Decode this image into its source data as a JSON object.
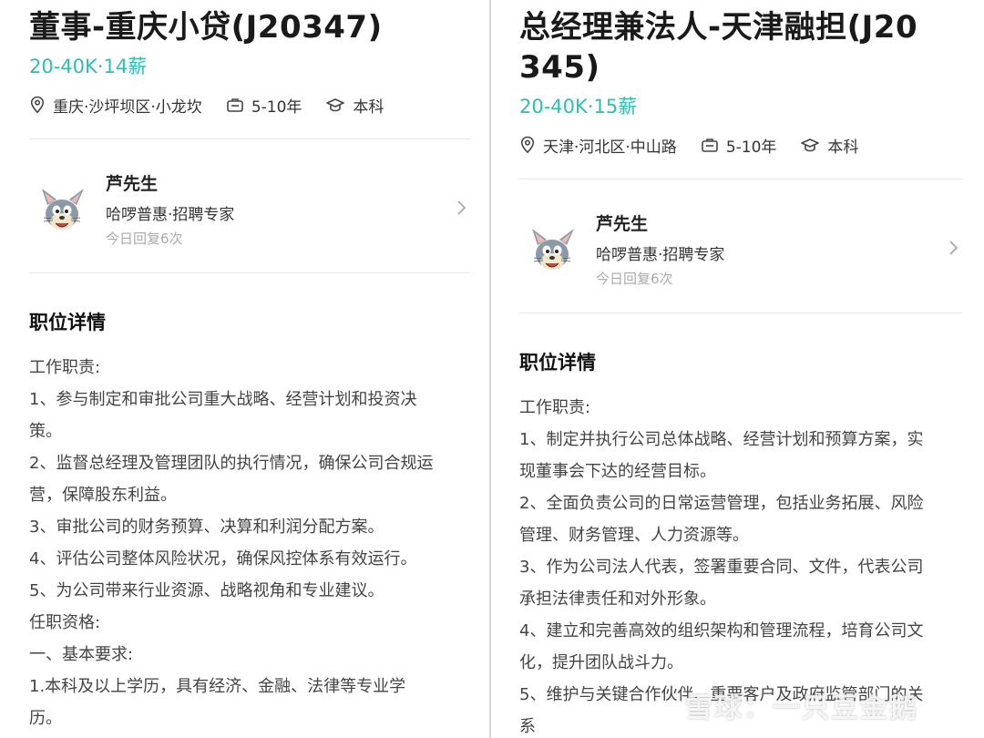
{
  "left": {
    "title": "董事-重庆小贷(J20347)",
    "salary": "20-40K·14薪",
    "location": "重庆·沙坪坝区·小龙坎",
    "experience": "5-10年",
    "education": "本科",
    "recruiter": {
      "name": "芦先生",
      "company": "哈啰普惠·招聘专家",
      "reply": "今日回复6次"
    },
    "section_title": "职位详情",
    "lines": [
      "工作职责:",
      "1、参与制定和审批公司重大战略、经营计划和投资决",
      "策。",
      "2、监督总经理及管理团队的执行情况，确保公司合规运",
      "营，保障股东利益。",
      "3、审批公司的财务预算、决算和利润分配方案。",
      "4、评估公司整体风险状况，确保风控体系有效运行。",
      "5、为公司带来行业资源、战略视角和专业建议。",
      "任职资格:",
      "一、基本要求:",
      "1.本科及以上学历，具有经济、金融、法律等专业学",
      "历。"
    ]
  },
  "right": {
    "title_line1": "总经理兼法人-天津融担(J20",
    "title_line2": "345)",
    "salary": "20-40K·15薪",
    "location": "天津·河北区·中山路",
    "experience": "5-10年",
    "education": "本科",
    "recruiter": {
      "name": "芦先生",
      "company": "哈啰普惠·招聘专家",
      "reply": "今日回复6次"
    },
    "section_title": "职位详情",
    "lines": [
      "工作职责:",
      "1、制定并执行公司总体战略、经营计划和预算方案，实",
      "现董事会下达的经营目标。",
      "2、全面负责公司的日常运营管理，包括业务拓展、风险",
      "管理、财务管理、人力资源等。",
      "3、作为公司法人代表，签署重要合同、文件，代表公司",
      "承担法律责任和对外形象。",
      "4、建立和完善高效的组织架构和管理流程，培育公司文",
      "化，提升团队战斗力。",
      "5、维护与关键合作伙伴、重要客户及政府监管部门的关",
      "系"
    ]
  },
  "watermark": "雪球：一只豆金鹅",
  "icons": {
    "location": "location-pin-icon",
    "experience": "briefcase-icon",
    "education": "graduation-cap-icon",
    "chevron": "chevron-right-icon"
  },
  "colors": {
    "salary": "#2cc0b3"
  }
}
